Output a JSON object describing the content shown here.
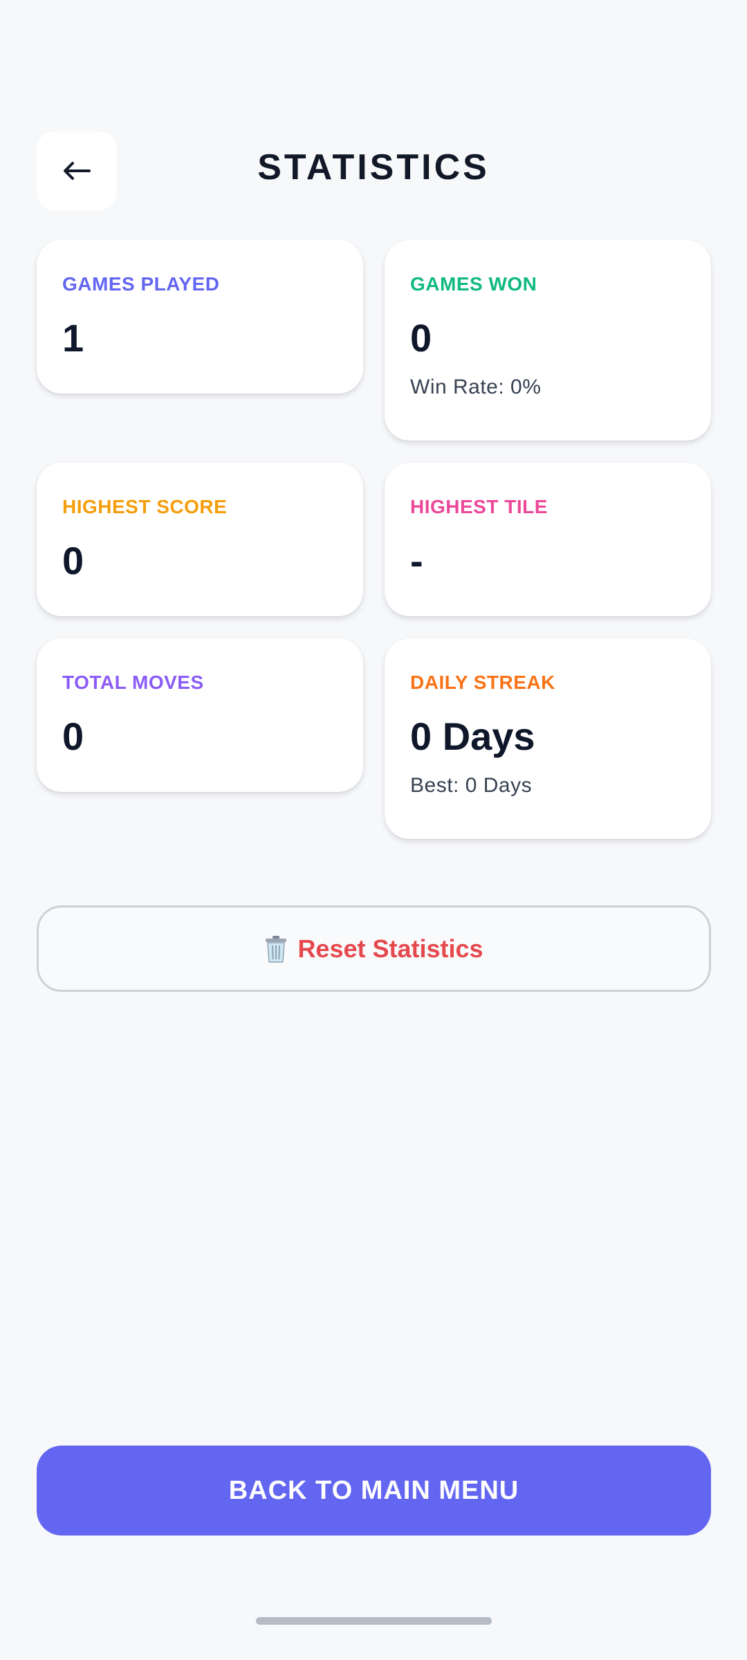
{
  "header": {
    "back_icon": "arrow-left-icon",
    "title": "STATISTICS"
  },
  "stats": {
    "games_played": {
      "label": "GAMES PLAYED",
      "value": "1",
      "color": "#6366f1"
    },
    "games_won": {
      "label": "GAMES WON",
      "value": "0",
      "sub": "Win Rate: 0%",
      "color": "#10b981"
    },
    "highest_score": {
      "label": "HIGHEST SCORE",
      "value": "0",
      "color": "#f59e0b"
    },
    "highest_tile": {
      "label": "HIGHEST TILE",
      "value": "-",
      "color": "#ec4899"
    },
    "total_moves": {
      "label": "TOTAL MOVES",
      "value": "0",
      "color": "#8b5cf6"
    },
    "daily_streak": {
      "label": "DAILY STREAK",
      "value": "0 Days",
      "sub": "Best: 0 Days",
      "color": "#f97316"
    }
  },
  "actions": {
    "reset_icon": "trash-icon",
    "reset_label": "Reset Statistics",
    "reset_color": "#e5484d",
    "main_menu_label": "BACK TO MAIN MENU",
    "main_menu_color": "#6366f1"
  }
}
